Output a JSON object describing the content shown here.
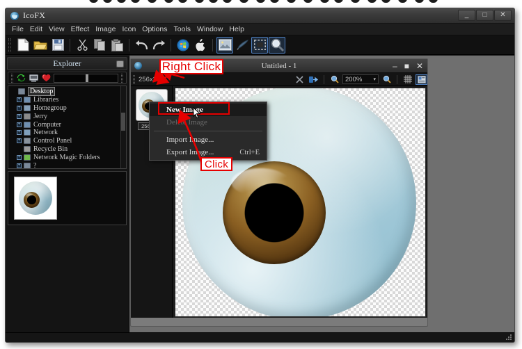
{
  "app": {
    "title": "IcoFX",
    "window_buttons": [
      "minimize",
      "maximize",
      "close"
    ],
    "min_glyph": "_",
    "max_glyph": "□",
    "close_glyph": "✕"
  },
  "menubar": {
    "items": [
      {
        "label": "File"
      },
      {
        "label": "Edit"
      },
      {
        "label": "View"
      },
      {
        "label": "Effect"
      },
      {
        "label": "Image"
      },
      {
        "label": "Icon"
      },
      {
        "label": "Options"
      },
      {
        "label": "Tools"
      },
      {
        "label": "Window"
      },
      {
        "label": "Help"
      }
    ]
  },
  "toolbar": {
    "buttons": [
      {
        "name": "new-document-icon",
        "glyph": "🗋"
      },
      {
        "name": "open-folder-icon",
        "glyph": "📂"
      },
      {
        "name": "save-icon",
        "glyph": "💾"
      },
      {
        "name": "cut-icon",
        "glyph": "✂"
      },
      {
        "name": "copy-icon",
        "glyph": "❐"
      },
      {
        "name": "paste-icon",
        "glyph": "📋"
      },
      {
        "name": "undo-icon",
        "glyph": "↶"
      },
      {
        "name": "redo-icon",
        "glyph": "↷"
      },
      {
        "name": "windows-icon",
        "glyph": "⊞"
      },
      {
        "name": "apple-icon",
        "glyph": ""
      },
      {
        "name": "image-icon",
        "glyph": "🖼"
      },
      {
        "name": "brush-icon",
        "glyph": "✒"
      },
      {
        "name": "select-icon",
        "glyph": "⬚"
      },
      {
        "name": "magnifier-icon",
        "glyph": "🔍"
      }
    ]
  },
  "explorer": {
    "header_title": "Explorer",
    "pin_icon": "pin-icon",
    "tools": [
      {
        "name": "refresh-icon",
        "glyph": "♻"
      },
      {
        "name": "display-icon",
        "glyph": "⬜"
      },
      {
        "name": "favorites-heart-icon",
        "glyph": "♥"
      }
    ],
    "path_value": "",
    "tree": [
      {
        "label": "Desktop",
        "expandable": false,
        "selected": true,
        "indent": 0
      },
      {
        "label": "Libraries",
        "expandable": true,
        "selected": false,
        "indent": 1
      },
      {
        "label": "Homegroup",
        "expandable": true,
        "selected": false,
        "indent": 1
      },
      {
        "label": "Jerry",
        "expandable": true,
        "selected": false,
        "indent": 1
      },
      {
        "label": "Computer",
        "expandable": true,
        "selected": false,
        "indent": 1
      },
      {
        "label": "Network",
        "expandable": true,
        "selected": false,
        "indent": 1
      },
      {
        "label": "Control Panel",
        "expandable": true,
        "selected": false,
        "indent": 1
      },
      {
        "label": "Recycle Bin",
        "expandable": false,
        "selected": false,
        "indent": 1
      },
      {
        "label": "Network Magic Folders",
        "expandable": true,
        "selected": false,
        "indent": 1
      },
      {
        "label": "?",
        "expandable": true,
        "selected": false,
        "indent": 1
      },
      {
        "label": "?",
        "expandable": true,
        "selected": false,
        "indent": 1
      }
    ],
    "preview_name": "eyeball-preview-thumbnail"
  },
  "document": {
    "title": "Untitled - 1",
    "min_glyph": "–",
    "max_glyph": "■",
    "close_glyph": "✕",
    "size_label": "256x256",
    "zoom_value": "200%",
    "zoom_caret": "▾",
    "tools": [
      {
        "name": "delete-image-icon",
        "glyph": "✕"
      },
      {
        "name": "export-image-icon",
        "glyph": "↳"
      },
      {
        "name": "zoom-out-icon",
        "glyph": "⌕"
      },
      {
        "name": "zoom-in-icon",
        "glyph": "⌕"
      },
      {
        "name": "grid-toggle-icon",
        "glyph": "⌗"
      },
      {
        "name": "preview-toggle-icon",
        "glyph": "▤"
      }
    ],
    "thumbnail_label": "256x256"
  },
  "context_menu": {
    "items": [
      {
        "label": "New Image",
        "shortcut": "",
        "state": "highlighted"
      },
      {
        "label": "Delete Image",
        "shortcut": "",
        "state": "disabled"
      },
      {
        "label": "Import Image...",
        "shortcut": "",
        "state": "normal"
      },
      {
        "label": "Export Image...",
        "shortcut": "Ctrl+E",
        "state": "normal"
      }
    ]
  },
  "annotations": [
    {
      "name": "right-click-annotation",
      "text": "Right Click"
    },
    {
      "name": "click-annotation",
      "text": "Click"
    }
  ],
  "colors": {
    "annotation_red": "#e60000",
    "window_bg": "#1c1c1c",
    "mdi_bg": "#6f6f6f",
    "accent_blue": "#4f7fbf"
  }
}
